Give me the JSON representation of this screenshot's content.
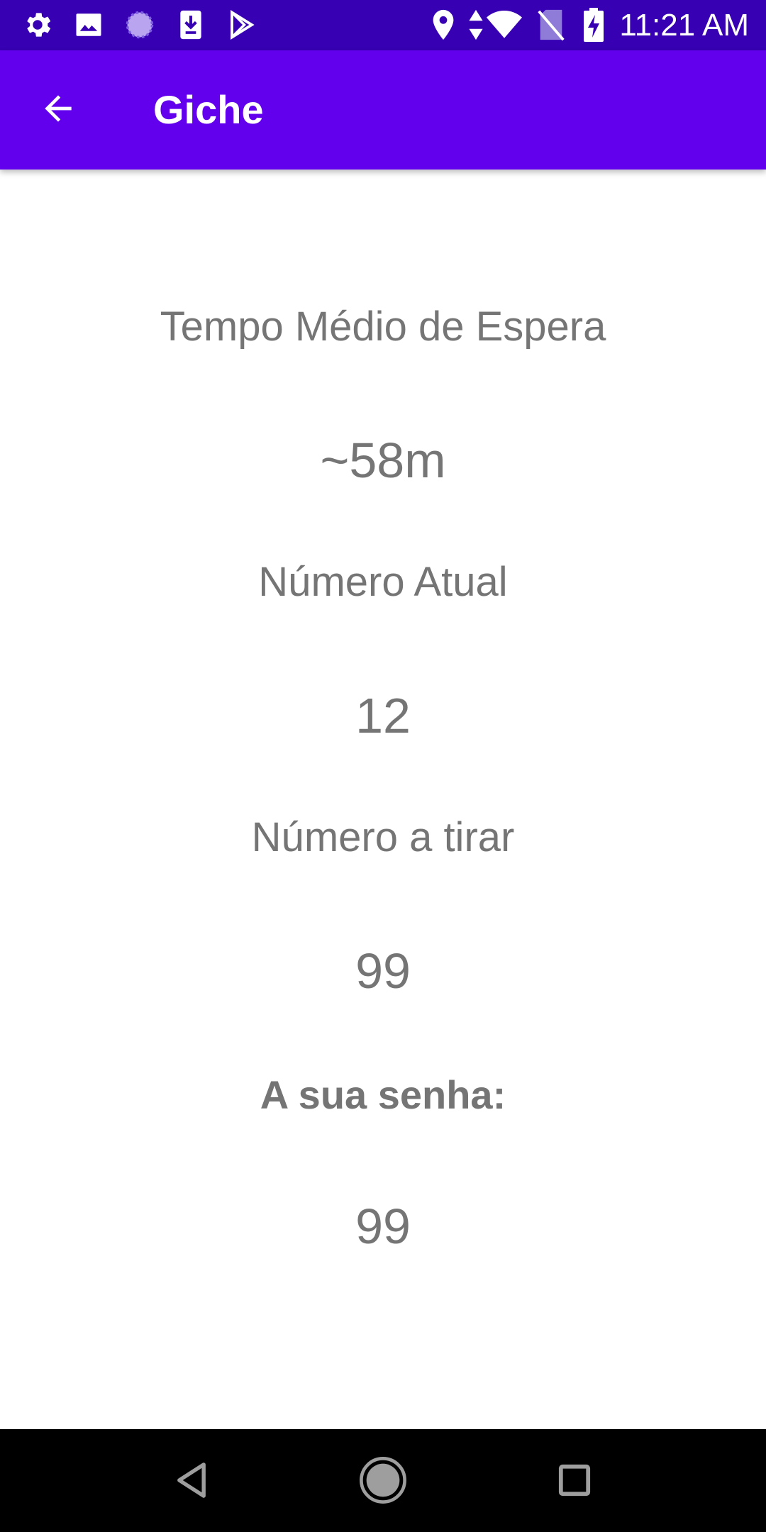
{
  "status_bar": {
    "time": "11:21 AM",
    "left_icons": [
      "settings-icon",
      "image-icon",
      "sync-icon",
      "download-icon",
      "play-store-icon"
    ],
    "right_icons": [
      "location-icon",
      "data-arrows-icon",
      "wifi-icon",
      "no-sim-icon",
      "battery-charging-icon"
    ]
  },
  "app_bar": {
    "title": "Giche",
    "back_icon": "arrow-back-icon"
  },
  "main": {
    "wait_label": "Tempo Médio de Espera",
    "wait_value": "~58m",
    "current_label": "Número Atual",
    "current_value": "12",
    "next_label": "Número a tirar",
    "next_value": "99",
    "ticket_label": "A sua senha:",
    "ticket_value": "99"
  },
  "nav_bar": {
    "icons": [
      "back-triangle-icon",
      "home-circle-icon",
      "recents-square-icon"
    ]
  },
  "colors": {
    "status_bar": "#3700b3",
    "app_bar": "#6200ee",
    "text": "#757575"
  }
}
